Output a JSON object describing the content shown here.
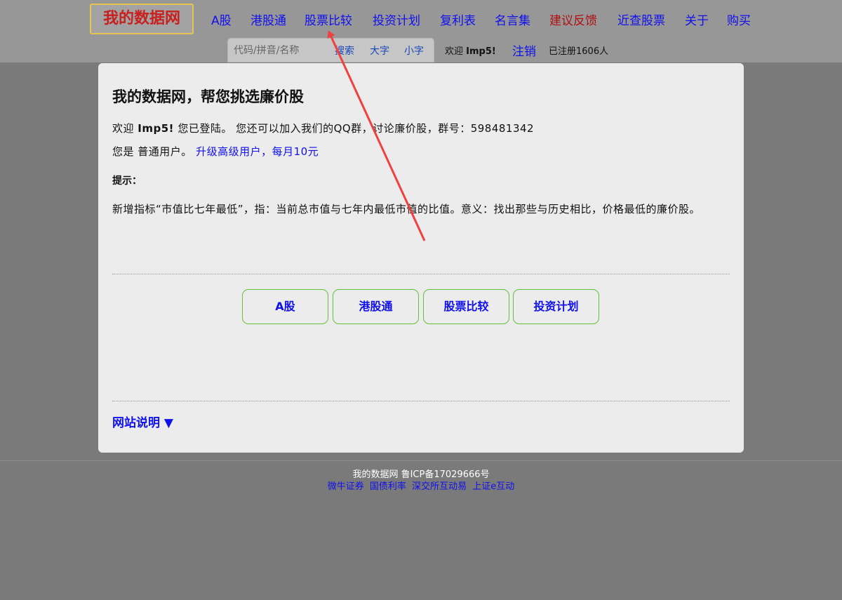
{
  "header": {
    "logo": "我的数据网",
    "nav": [
      {
        "label": "A股",
        "color": "#1010ee"
      },
      {
        "label": "港股通",
        "color": "#1010ee"
      },
      {
        "label": "股票比较",
        "color": "#1010ee"
      },
      {
        "label": "投资计划",
        "color": "#1010ee"
      },
      {
        "label": "复利表",
        "color": "#1010ee"
      },
      {
        "label": "名言集",
        "color": "#1010ee"
      },
      {
        "label": "建议反馈",
        "color": "#b01010"
      },
      {
        "label": "近查股票",
        "color": "#1010ee"
      },
      {
        "label": "关于",
        "color": "#1010ee"
      },
      {
        "label": "购买",
        "color": "#1010ee"
      }
    ],
    "search": {
      "placeholder": "代码/拼音/名称",
      "search_label": "搜索",
      "big_font_label": "大字",
      "small_font_label": "小字"
    },
    "welcome_prefix": "欢迎",
    "username": "Imp5!",
    "logout_label": "注销",
    "registered_text": "已注册1606人"
  },
  "panel": {
    "title": "我的数据网，帮您挑选廉价股",
    "welcome_prefix": "欢迎",
    "username": "Imp5!",
    "welcome_suffix": "您已登陆。 您还可以加入我们的QQ群，讨论廉价股，群号：598481342",
    "usertype_text": "您是 普通用户。",
    "upgrade_link": "升级高级用户，每月10元",
    "tip_label": "提示：",
    "tip_text": "新增指标“市值比七年最低”，指：当前总市值与七年内最低市值的比值。意义：找出那些与历史相比，价格最低的廉价股。",
    "buttons": [
      "A股",
      "港股通",
      "股票比较",
      "投资计划"
    ],
    "site_info_label": "网站说明 ▼"
  },
  "footer": {
    "icp": "我的数据网 鲁ICP备17029666号",
    "links": [
      "微牛证券",
      "国债利率",
      "深交所互动易",
      "上证e互动"
    ]
  },
  "colors": {
    "link": "#1010ee",
    "accent_red": "#c8201f",
    "button_border": "#62c13a",
    "annotation_arrow": "#f04040"
  }
}
